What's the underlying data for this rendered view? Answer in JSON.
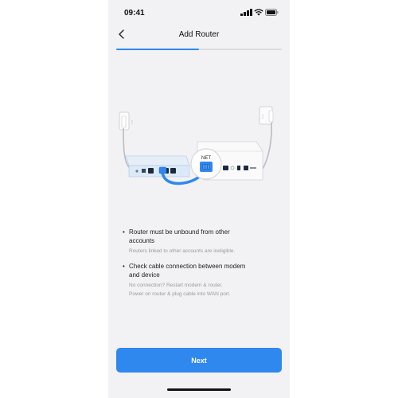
{
  "status_bar": {
    "time": "09:41",
    "icons": [
      "signal-icon",
      "wifi-icon",
      "battery-icon"
    ]
  },
  "header": {
    "back_icon": "chevron-left-icon",
    "title": "Add Router"
  },
  "progress": {
    "value_fraction": 0.5
  },
  "illustration": {
    "net_label": "NET"
  },
  "checklist": [
    {
      "title_lines": [
        "Router must be unbound from other",
        "accounts"
      ],
      "notes": [
        "Routers linked to other accounts are ineligible."
      ]
    },
    {
      "title_lines": [
        "Check cable connection between modem",
        "and device"
      ],
      "notes": [
        "No connection? Restart modem & router.",
        "Power on router & plug cable into WAN port."
      ]
    }
  ],
  "footer": {
    "next_label": "Next"
  },
  "colors": {
    "accent": "#2f88ee",
    "background": "#f2f2f4",
    "title_text": "#222222",
    "note_text": "#999aa0"
  }
}
